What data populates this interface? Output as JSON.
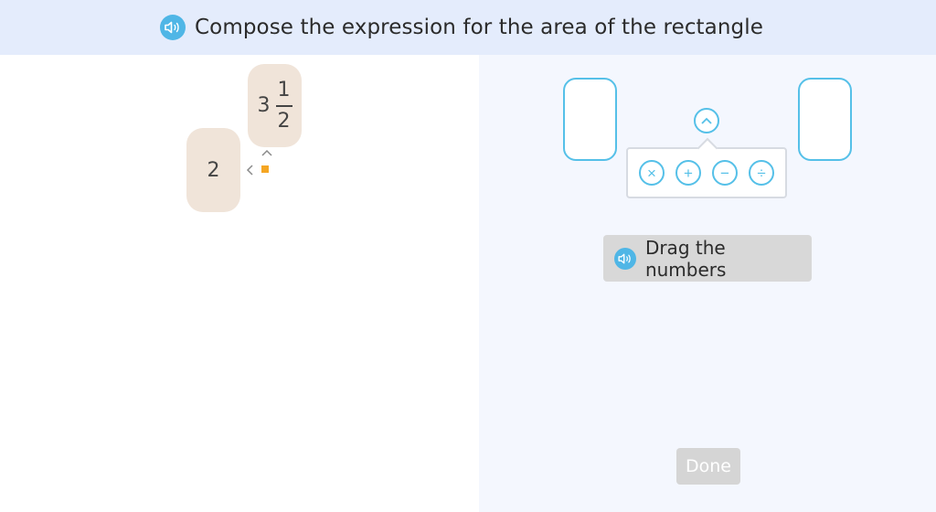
{
  "header": {
    "title": "Compose the expression for the area of the rectangle",
    "speaker_icon": "speaker-icon"
  },
  "tiles": {
    "mixed": {
      "whole": "3",
      "numerator": "1",
      "denominator": "2"
    },
    "two": {
      "value": "2"
    }
  },
  "operations": {
    "items": [
      {
        "name": "multiply",
        "symbol": "×"
      },
      {
        "name": "add",
        "symbol": "+"
      },
      {
        "name": "subtract",
        "symbol": "−"
      },
      {
        "name": "divide",
        "symbol": "÷"
      }
    ]
  },
  "hint": {
    "label": "Drag the numbers"
  },
  "done": {
    "label": "Done"
  },
  "colors": {
    "accent": "#55c0e8",
    "header_bg": "#e4ecfc",
    "tile_bg": "#f0e4d9",
    "rect_marker": "#f5a623",
    "done_disabled": "#d5d5d5"
  }
}
